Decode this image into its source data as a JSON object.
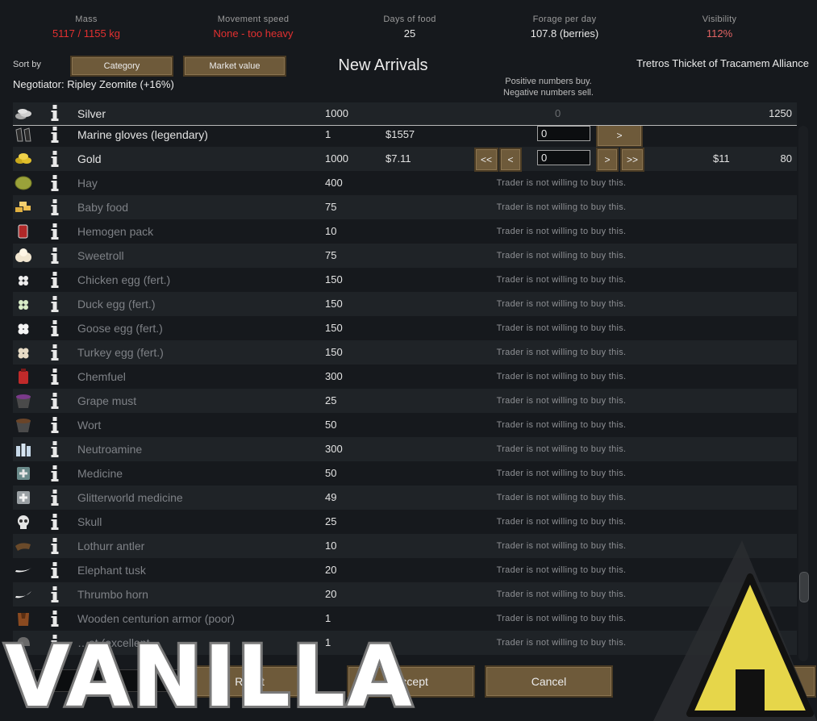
{
  "stats": [
    {
      "label": "Mass",
      "value": "5117 / 1155 kg",
      "tone": "red"
    },
    {
      "label": "Movement speed",
      "value": "None - too heavy",
      "tone": "red"
    },
    {
      "label": "Days of food",
      "value": "25",
      "tone": "normal"
    },
    {
      "label": "Forage per day",
      "value": "107.8 (berries)",
      "tone": "normal"
    },
    {
      "label": "Visibility",
      "value": "112%",
      "tone": "pink"
    }
  ],
  "sort": {
    "label": "Sort by",
    "button1": "Category",
    "button2": "Market value"
  },
  "title": "New Arrivals",
  "faction": "Tretros Thicket of Tracamem Alliance",
  "negotiator": "Negotiator: Ripley Zeomite (+16%)",
  "hint": {
    "line1": "Positive numbers buy.",
    "line2": "Negative numbers sell."
  },
  "silver": {
    "name": "Silver",
    "qty": "1000",
    "mid": "0",
    "trader_qty": "1250"
  },
  "rows": [
    {
      "name": "Marine gloves (legendary)",
      "qty": "1",
      "price": "$1557",
      "input": "0",
      "buttons": [
        ">"
      ],
      "active": true
    },
    {
      "name": "Gold",
      "qty": "1000",
      "price": "$7.11",
      "input": "0",
      "buttons": [
        "<<",
        "<",
        ">",
        ">>"
      ],
      "trader_price": "$11",
      "trader_qty": "80",
      "active": true
    },
    {
      "name": "Hay",
      "qty": "400",
      "note": "Trader is not willing to buy this."
    },
    {
      "name": "Baby food",
      "qty": "75",
      "note": "Trader is not willing to buy this."
    },
    {
      "name": "Hemogen pack",
      "qty": "10",
      "note": "Trader is not willing to buy this."
    },
    {
      "name": "Sweetroll",
      "qty": "75",
      "note": "Trader is not willing to buy this."
    },
    {
      "name": "Chicken egg (fert.)",
      "qty": "150",
      "note": "Trader is not willing to buy this."
    },
    {
      "name": "Duck egg (fert.)",
      "qty": "150",
      "note": "Trader is not willing to buy this."
    },
    {
      "name": "Goose egg (fert.)",
      "qty": "150",
      "note": "Trader is not willing to buy this."
    },
    {
      "name": "Turkey egg (fert.)",
      "qty": "150",
      "note": "Trader is not willing to buy this."
    },
    {
      "name": "Chemfuel",
      "qty": "300",
      "note": "Trader is not willing to buy this."
    },
    {
      "name": "Grape must",
      "qty": "25",
      "note": "Trader is not willing to buy this."
    },
    {
      "name": "Wort",
      "qty": "50",
      "note": "Trader is not willing to buy this."
    },
    {
      "name": "Neutroamine",
      "qty": "300",
      "note": "Trader is not willing to buy this."
    },
    {
      "name": "Medicine",
      "qty": "50",
      "note": "Trader is not willing to buy this."
    },
    {
      "name": "Glitterworld medicine",
      "qty": "49",
      "note": "Trader is not willing to buy this."
    },
    {
      "name": "Skull",
      "qty": "25",
      "note": "Trader is not willing to buy this."
    },
    {
      "name": "Lothurr antler",
      "qty": "10",
      "note": "Trader is not willing to buy this."
    },
    {
      "name": "Elephant tusk",
      "qty": "20",
      "note": "Trader is not willing to buy this."
    },
    {
      "name": "Thrumbo horn",
      "qty": "20",
      "note": "Trader is not willing to buy this."
    },
    {
      "name": "Wooden centurion armor (poor)",
      "qty": "1",
      "note": "Trader is not willing to buy this."
    },
    {
      "name": "…et (excellent",
      "qty": "1",
      "note": "Trader is not willing to buy this."
    }
  ],
  "buttons": {
    "reset": "Reset",
    "accept": "Accept",
    "cancel": "Cancel"
  },
  "watermark": "VANILLA",
  "colors": {
    "button": "#6e5a3a",
    "red": "#e23030",
    "logo_yellow": "#e6d64a"
  }
}
